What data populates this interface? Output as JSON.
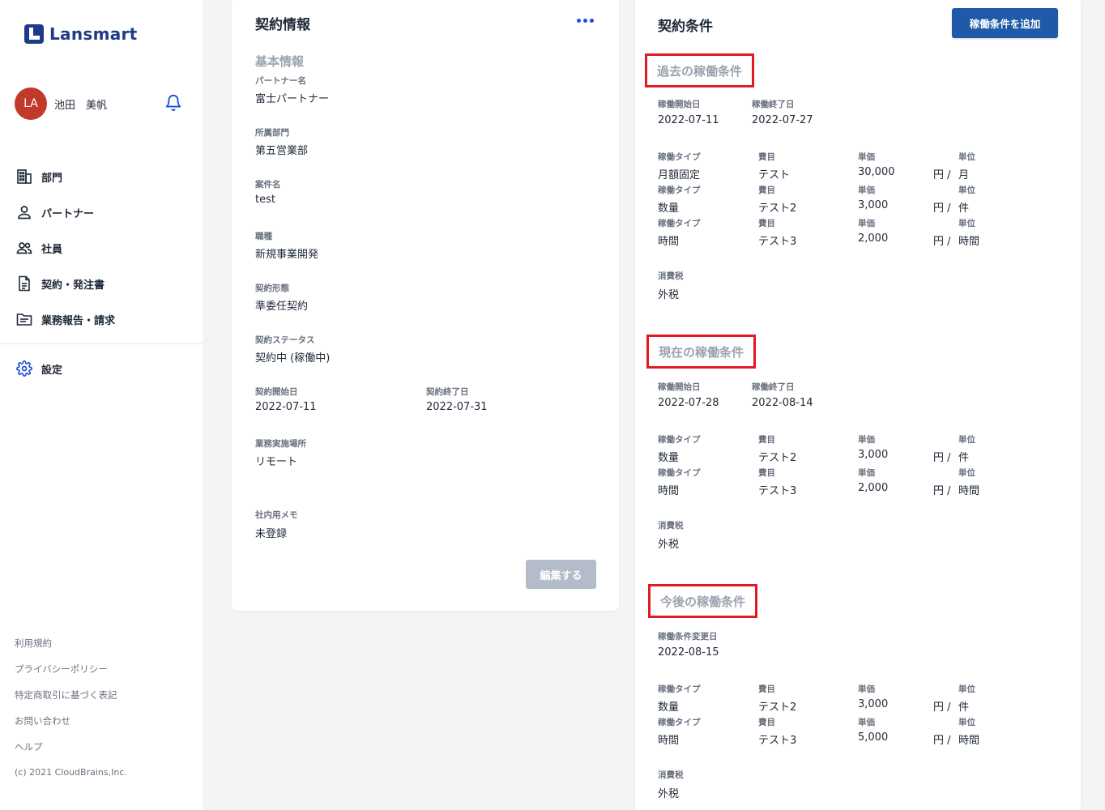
{
  "brand": {
    "logo_text": "Lansmart"
  },
  "user": {
    "initials": "LA",
    "name": "池田　美帆"
  },
  "nav": {
    "items": [
      {
        "label": "部門",
        "icon": "building-icon"
      },
      {
        "label": "パートナー",
        "icon": "person-icon"
      },
      {
        "label": "社員",
        "icon": "people-icon"
      },
      {
        "label": "契約・発注書",
        "icon": "document-icon"
      },
      {
        "label": "業務報告・請求",
        "icon": "folder-icon"
      }
    ],
    "settings": {
      "label": "設定",
      "icon": "gear-icon"
    }
  },
  "footer": {
    "links": [
      "利用規約",
      "プライバシーポリシー",
      "特定商取引に基づく表記",
      "お問い合わせ",
      "ヘルプ"
    ],
    "copyright": "(c) 2021 CloudBrains,Inc."
  },
  "contract": {
    "title": "契約情報",
    "section": "基本情報",
    "partner_label": "パートナー名",
    "partner_value": "富士パートナー",
    "dept_label": "所属部門",
    "dept_value": "第五営業部",
    "project_label": "案件名",
    "project_value": "test",
    "job_label": "職種",
    "job_value": "新規事業開発",
    "form_label": "契約形態",
    "form_value": "準委任契約",
    "status_label": "契約ステータス",
    "status_value": "契約中 (稼働中)",
    "start_label": "契約開始日",
    "start_value": "2022-07-11",
    "end_label": "契約終了日",
    "end_value": "2022-07-31",
    "place_label": "業務実施場所",
    "place_value": "リモート",
    "memo_label": "社内用メモ",
    "memo_value": "未登録",
    "edit_button": "編集する"
  },
  "conditions": {
    "title": "契約条件",
    "add_button": "稼働条件を追加",
    "labels": {
      "start": "稼働開始日",
      "end": "稼働終了日",
      "change_date": "稼働条件変更日",
      "type": "稼働タイプ",
      "item": "費目",
      "price": "単価",
      "unit": "単位",
      "tax": "消費税",
      "yen": "円 /"
    },
    "past": {
      "heading": "過去の稼働条件",
      "start": "2022-07-11",
      "end": "2022-07-27",
      "rows": [
        {
          "type": "月額固定",
          "item": "テスト",
          "price": "30,000",
          "unit": "月"
        },
        {
          "type": "数量",
          "item": "テスト2",
          "price": "3,000",
          "unit": "件"
        },
        {
          "type": "時間",
          "item": "テスト3",
          "price": "2,000",
          "unit": "時間"
        }
      ],
      "tax": "外税"
    },
    "current": {
      "heading": "現在の稼働条件",
      "start": "2022-07-28",
      "end": "2022-08-14",
      "rows": [
        {
          "type": "数量",
          "item": "テスト2",
          "price": "3,000",
          "unit": "件"
        },
        {
          "type": "時間",
          "item": "テスト3",
          "price": "2,000",
          "unit": "時間"
        }
      ],
      "tax": "外税"
    },
    "future": {
      "heading": "今後の稼働条件",
      "change_date": "2022-08-15",
      "rows": [
        {
          "type": "数量",
          "item": "テスト2",
          "price": "3,000",
          "unit": "件"
        },
        {
          "type": "時間",
          "item": "テスト3",
          "price": "5,000",
          "unit": "時間"
        }
      ],
      "tax": "外税"
    }
  },
  "colors": {
    "accent": "#1e5aa8",
    "avatar": "#c0392b",
    "highlight": "#e01b24"
  }
}
